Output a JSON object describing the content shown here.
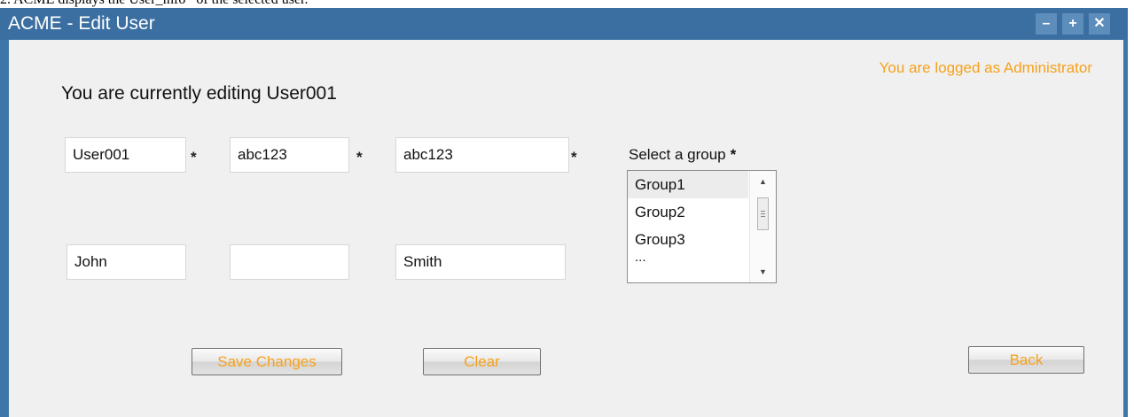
{
  "caption": "2. ACME displays the User_info* of the selected user.",
  "window": {
    "title": "ACME - Edit User",
    "controls": {
      "minimize": "–",
      "maximize": "+",
      "close": "✕"
    }
  },
  "logged_text": "You are logged as Administrator",
  "heading": "You are currently editing User001",
  "fields": {
    "username": "User001",
    "password": "abc123",
    "confirm_password": "abc123",
    "first_name": "John",
    "middle_name": "",
    "last_name": "Smith",
    "required_mark": "*"
  },
  "group": {
    "label": "Select a group",
    "required_mark": "*",
    "options": [
      "Group1",
      "Group2",
      "Group3"
    ],
    "more": "...",
    "selected": "Group1"
  },
  "buttons": {
    "save": "Save Changes",
    "clear": "Clear",
    "back": "Back"
  },
  "colors": {
    "accent": "#f7a11a",
    "titlebar": "#3b6fa1",
    "window_bg": "#f0f0f0"
  },
  "icons": {
    "minimize": "minimize-icon",
    "maximize": "maximize-icon",
    "close": "close-icon",
    "scroll_up": "scroll-up-arrow-icon",
    "scroll_down": "scroll-down-arrow-icon"
  }
}
